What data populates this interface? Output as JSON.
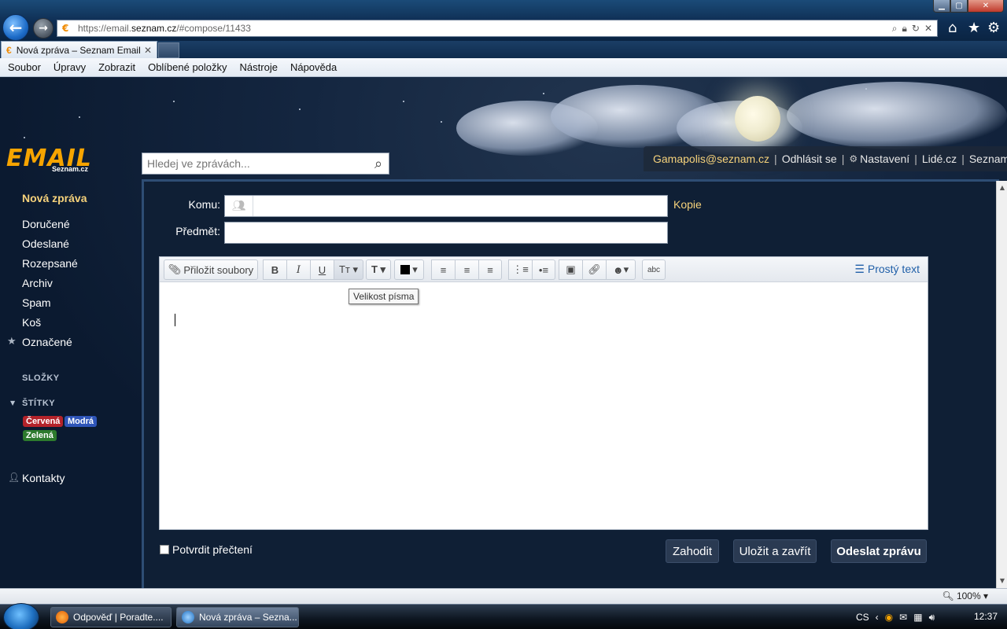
{
  "browser": {
    "url_prefix": "https://email.",
    "url_domain": "seznam.cz",
    "url_path": "/#compose/11433",
    "tab_title": "Nová zpráva – Seznam Email",
    "menu": [
      "Soubor",
      "Úpravy",
      "Zobrazit",
      "Oblíbené položky",
      "Nástroje",
      "Nápověda"
    ],
    "zoom": "100%"
  },
  "header": {
    "logo_main": "EMAIL",
    "logo_sub": "Seznam.cz",
    "search_placeholder": "Hledej ve zprávách...",
    "user_email": "Gamapolis@seznam.cz",
    "logout": "Odhlásit se",
    "settings": "Nastavení",
    "lide": "Lidé.cz",
    "seznam": "Seznam.cz"
  },
  "sidebar": {
    "new_message": "Nová zpráva",
    "items": [
      "Doručené",
      "Odeslané",
      "Rozepsané",
      "Archiv",
      "Spam",
      "Koš",
      "Označené"
    ],
    "folders_heading": "SLOŽKY",
    "tags_heading": "ŠTÍTKY",
    "tags": [
      {
        "label": "Červená",
        "color": "#b3232a"
      },
      {
        "label": "Modrá",
        "color": "#2f55b8"
      },
      {
        "label": "Zelená",
        "color": "#2d7a2d"
      }
    ],
    "contacts": "Kontakty"
  },
  "compose": {
    "to_label": "Komu:",
    "copy_link": "Kopie",
    "subject_label": "Předmět:",
    "attach_label": "Přiložit soubory",
    "plain_text": "Prostý text",
    "tooltip": "Velikost písma",
    "confirm_read": "Potvrdit přečtení",
    "discard": "Zahodit",
    "save_close": "Uložit a zavřít",
    "send": "Odeslat zprávu"
  },
  "taskbar": {
    "tasks": [
      "Odpověď | Poradte....",
      "Nová zpráva – Sezna..."
    ],
    "lang": "CS",
    "clock": "12:37"
  }
}
